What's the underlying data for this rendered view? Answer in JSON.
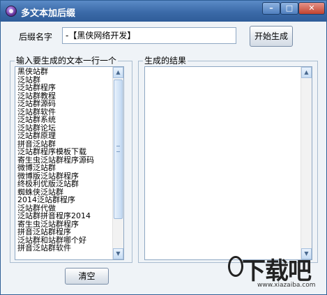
{
  "window": {
    "title": "多文本加后缀"
  },
  "titlebar_buttons": {
    "minimize": "–",
    "maximize": "□",
    "close": "✕"
  },
  "suffix": {
    "label": "后缀名字",
    "value": "-【黑侠网络开发】"
  },
  "generate_button": "开始生成",
  "input_group": {
    "title": "输入要生成的文本一行一个",
    "lines": [
      "黑侠站群",
      "泛站群",
      "泛站群程序",
      "泛站群教程",
      "泛站群源码",
      "泛站群软件",
      "泛站群系统",
      "泛站群论坛",
      "泛站群原理",
      "拼音泛站群",
      "泛站群程序模板下载",
      "寄生虫泛站群程序源码",
      "微博泛站群",
      "微博版泛站群程序",
      "终极利优版泛站群",
      "蜘蛛侠泛站群",
      "2014泛站群程序",
      "泛站群代做",
      "泛站群拼音程序2014",
      "寄生虫泛站群程序",
      "拼音泛站群程序",
      "泛站群和站群哪个好",
      "拼音泛站群软件"
    ]
  },
  "output_group": {
    "title": "生成的结果",
    "value": ""
  },
  "clear_button": "清空",
  "scroll_arrows": {
    "up": "▲",
    "down": "▼"
  },
  "watermark": {
    "text": "下载吧",
    "url": "www.xiazaiba.com"
  },
  "colors": {
    "titlebar": "#3b6aa8",
    "window_bg": "#eff3f7",
    "close_button": "#c2432f"
  }
}
